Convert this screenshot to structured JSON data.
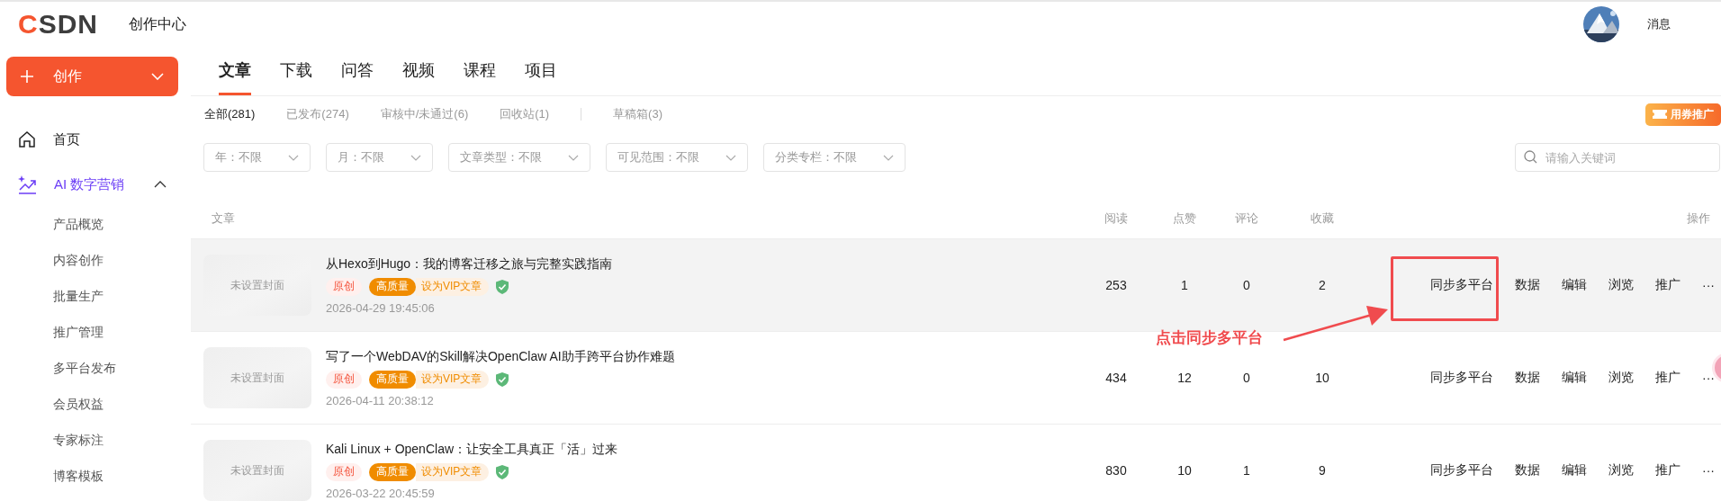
{
  "header": {
    "logo": "CSDN",
    "title": "创作中心",
    "messages": "消息"
  },
  "sidebar": {
    "create_button": "创作",
    "items": [
      {
        "label": "首页",
        "selected": false
      },
      {
        "label": "AI 数字营销",
        "selected": true,
        "expanded": true,
        "children": [
          {
            "label": "产品概览",
            "selected": false
          },
          {
            "label": "内容创作",
            "selected": false
          },
          {
            "label": "批量生产",
            "selected": false
          },
          {
            "label": "推广管理",
            "selected": false
          },
          {
            "label": "多平台发布",
            "selected": false
          },
          {
            "label": "会员权益",
            "selected": false
          },
          {
            "label": "专家标注",
            "selected": false
          },
          {
            "label": "博客模板",
            "selected": false
          }
        ]
      }
    ]
  },
  "tabs": [
    {
      "label": "文章",
      "selected": true
    },
    {
      "label": "下载",
      "selected": false
    },
    {
      "label": "问答",
      "selected": false
    },
    {
      "label": "视频",
      "selected": false
    },
    {
      "label": "课程",
      "selected": false
    },
    {
      "label": "项目",
      "selected": false
    }
  ],
  "status_filters": [
    {
      "label": "全部(281)",
      "selected": true
    },
    {
      "label": "已发布(274)",
      "selected": false
    },
    {
      "label": "审核中/未通过(6)",
      "selected": false
    },
    {
      "label": "回收站(1)",
      "selected": false
    }
  ],
  "drafts_filter": {
    "label": "草稿箱(3)",
    "selected": false
  },
  "promo_badge": "用券推广",
  "filters": [
    {
      "label": "年：不限"
    },
    {
      "label": "月：不限"
    },
    {
      "label": "文章类型：不限"
    },
    {
      "label": "可见范围：不限"
    },
    {
      "label": "分类专栏：不限"
    }
  ],
  "search": {
    "placeholder": "请输入关键词"
  },
  "table": {
    "columns": [
      "文章",
      "阅读",
      "点赞",
      "评论",
      "收藏",
      "操作"
    ],
    "rows": [
      {
        "cover": "未设置封面",
        "title": "从Hexo到Hugo：我的博客迁移之旅与完整实践指南",
        "tags": [
          {
            "label": "原创",
            "kind": "original"
          },
          {
            "label": "高质量",
            "kind": "quality"
          },
          {
            "label": "设为VIP文章",
            "kind": "vip"
          }
        ],
        "verified": true,
        "date": "2026-04-29 19:45:06",
        "reads": "253",
        "likes": "1",
        "comments": "0",
        "favorites": "2",
        "actions": [
          "同步多平台",
          "数据",
          "编辑",
          "浏览",
          "推广",
          "···"
        ],
        "hovered": true
      },
      {
        "cover": "未设置封面",
        "title": "写了一个WebDAV的Skill解决OpenClaw AI助手跨平台协作难题",
        "tags": [
          {
            "label": "原创",
            "kind": "original"
          },
          {
            "label": "高质量",
            "kind": "quality"
          },
          {
            "label": "设为VIP文章",
            "kind": "vip"
          }
        ],
        "verified": true,
        "date": "2026-04-11 20:38:12",
        "reads": "434",
        "likes": "12",
        "comments": "0",
        "favorites": "10",
        "actions": [
          "同步多平台",
          "数据",
          "编辑",
          "浏览",
          "推广",
          "···"
        ],
        "hovered": false
      },
      {
        "cover": "未设置封面",
        "title": "Kali Linux + OpenClaw：让安全工具真正「活」过来",
        "tags": [
          {
            "label": "原创",
            "kind": "original"
          },
          {
            "label": "高质量",
            "kind": "quality"
          },
          {
            "label": "设为VIP文章",
            "kind": "vip"
          }
        ],
        "verified": true,
        "date": "2026-03-22 20:45:59",
        "reads": "830",
        "likes": "10",
        "comments": "1",
        "favorites": "9",
        "actions": [
          "同步多平台",
          "数据",
          "编辑",
          "浏览",
          "推广",
          "···"
        ],
        "hovered": false
      }
    ]
  },
  "annotation": {
    "label": "点击同步多平台"
  }
}
